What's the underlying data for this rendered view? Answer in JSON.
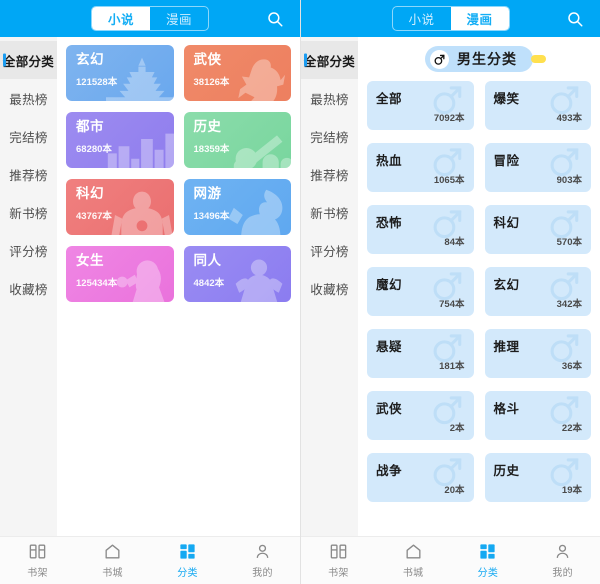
{
  "accent": "#00a7f5",
  "left_screen": {
    "topbar": {
      "tabs": [
        {
          "label": "小说",
          "active": true
        },
        {
          "label": "漫画",
          "active": false
        }
      ],
      "search_icon": "search-icon"
    },
    "sidebar": {
      "items": [
        {
          "label": "全部分类",
          "active": true
        },
        {
          "label": "最热榜",
          "active": false
        },
        {
          "label": "完结榜",
          "active": false
        },
        {
          "label": "推荐榜",
          "active": false
        },
        {
          "label": "新书榜",
          "active": false
        },
        {
          "label": "评分榜",
          "active": false
        },
        {
          "label": "收藏榜",
          "active": false
        }
      ]
    },
    "categories": [
      {
        "name": "玄幻",
        "count": "121528本",
        "color_start": "#7fb4ef",
        "color_end": "#6aa8ee",
        "art": "castle"
      },
      {
        "name": "武侠",
        "count": "38126本",
        "color_start": "#f08a69",
        "color_end": "#ed7f5f",
        "art": "warrior"
      },
      {
        "name": "都市",
        "count": "68280本",
        "color_start": "#9d8cf0",
        "color_end": "#8f7dee",
        "art": "city"
      },
      {
        "name": "历史",
        "count": "18359本",
        "color_start": "#8bdcab",
        "color_end": "#79d69e",
        "art": "army"
      },
      {
        "name": "科幻",
        "count": "43767本",
        "color_start": "#f0807f",
        "color_end": "#ea6f70",
        "art": "robot"
      },
      {
        "name": "网游",
        "count": "13496本",
        "color_start": "#6fb3f2",
        "color_end": "#5fa8f0",
        "art": "gamer"
      },
      {
        "name": "女生",
        "count": "125434本",
        "color_start": "#ef86e4",
        "color_end": "#ea72dc",
        "art": "girl"
      },
      {
        "name": "同人",
        "count": "4842本",
        "color_start": "#9a8cf3",
        "color_end": "#8b7cf0",
        "art": "fanart"
      }
    ],
    "tabbar": [
      {
        "label": "书架",
        "icon": "bookshelf-icon",
        "active": false
      },
      {
        "label": "书城",
        "icon": "home-icon",
        "active": false
      },
      {
        "label": "分类",
        "icon": "grid-icon",
        "active": true
      },
      {
        "label": "我的",
        "icon": "person-icon",
        "active": false
      }
    ]
  },
  "right_screen": {
    "topbar": {
      "tabs": [
        {
          "label": "小说",
          "active": false
        },
        {
          "label": "漫画",
          "active": true
        }
      ],
      "search_icon": "search-icon"
    },
    "sidebar": {
      "items": [
        {
          "label": "全部分类",
          "active": true
        },
        {
          "label": "最热榜",
          "active": false
        },
        {
          "label": "完结榜",
          "active": false
        },
        {
          "label": "推荐榜",
          "active": false
        },
        {
          "label": "新书榜",
          "active": false
        },
        {
          "label": "评分榜",
          "active": false
        },
        {
          "label": "收藏榜",
          "active": false
        }
      ]
    },
    "badge": {
      "label": "男生分类",
      "icon": "male-symbol-icon",
      "bg": "#bfe0fb",
      "dot_color": "#ffe04f"
    },
    "categories": [
      {
        "name": "全部",
        "count": "7092本"
      },
      {
        "name": "爆笑",
        "count": "493本"
      },
      {
        "name": "热血",
        "count": "1065本"
      },
      {
        "name": "冒险",
        "count": "903本"
      },
      {
        "name": "恐怖",
        "count": "84本"
      },
      {
        "name": "科幻",
        "count": "570本"
      },
      {
        "name": "魔幻",
        "count": "754本"
      },
      {
        "name": "玄幻",
        "count": "342本"
      },
      {
        "name": "悬疑",
        "count": "181本"
      },
      {
        "name": "推理",
        "count": "36本"
      },
      {
        "name": "武侠",
        "count": "2本"
      },
      {
        "name": "格斗",
        "count": "22本"
      },
      {
        "name": "战争",
        "count": "20本"
      },
      {
        "name": "历史",
        "count": "19本"
      }
    ],
    "tabbar": [
      {
        "label": "书架",
        "icon": "bookshelf-icon",
        "active": false
      },
      {
        "label": "书城",
        "icon": "home-icon",
        "active": false
      },
      {
        "label": "分类",
        "icon": "grid-icon",
        "active": true
      },
      {
        "label": "我的",
        "icon": "person-icon",
        "active": false
      }
    ]
  }
}
